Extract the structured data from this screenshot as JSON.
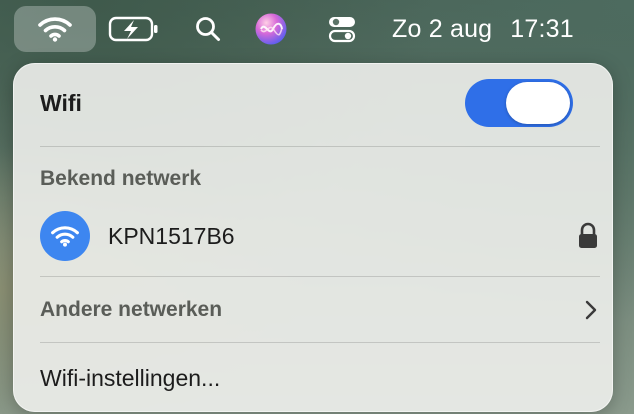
{
  "menubar": {
    "icons": [
      "wifi-icon",
      "battery-charging-icon",
      "search-icon",
      "siri-icon",
      "control-center-icon"
    ],
    "date": "Zo 2 aug",
    "time": "17:31"
  },
  "wifi_panel": {
    "title": "Wifi",
    "toggle_on": true,
    "known_section_label": "Bekend netwerk",
    "known_networks": [
      {
        "name": "KPN1517B6",
        "secured": true,
        "icon": "wifi-icon",
        "lock_icon": "lock-icon"
      }
    ],
    "other_networks_label": "Andere netwerken",
    "other_networks_icon": "chevron-right-icon",
    "settings_label": "Wifi-instellingen..."
  },
  "colors": {
    "accent_blue": "#2f6fe8",
    "network_icon_blue": "#3d86f0",
    "panel_background": "#eef0ec",
    "primary_text": "#1c1c1c",
    "secondary_text": "#5a5d58"
  }
}
